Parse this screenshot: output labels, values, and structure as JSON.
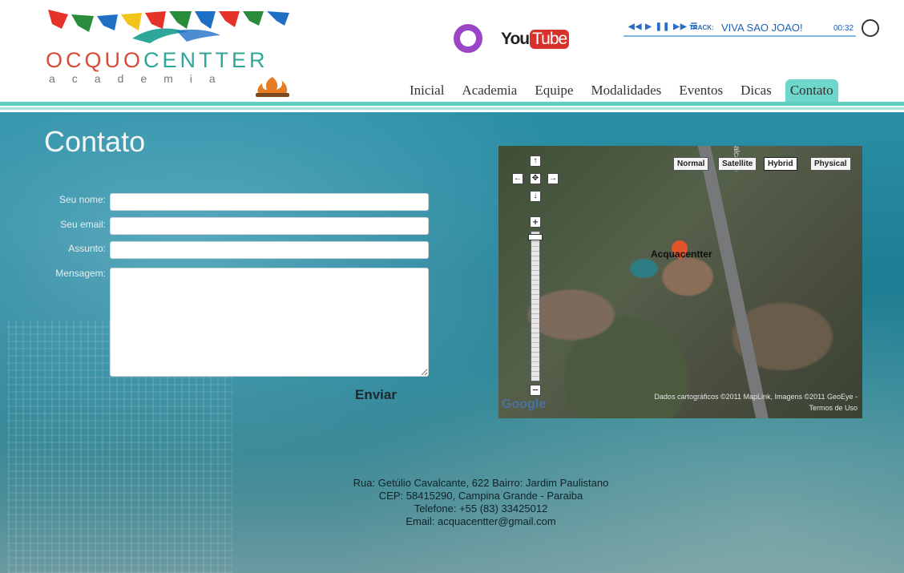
{
  "logo": {
    "name_prefix": "OCQUO",
    "name_suffix": "CENTTER",
    "subtitle": "academia"
  },
  "social": {
    "youtube_you": "You",
    "youtube_tube": "Tube"
  },
  "player": {
    "controls": "◀◀ ▶ ❚❚ ▶▶ ☰",
    "track_label": "TRACK:",
    "track_name": "VIVA SAO JOAO!",
    "time": "00:32"
  },
  "nav": {
    "items": [
      {
        "label": "Inicial"
      },
      {
        "label": "Academia"
      },
      {
        "label": "Equipe"
      },
      {
        "label": "Modalidades"
      },
      {
        "label": "Eventos"
      },
      {
        "label": "Dicas"
      },
      {
        "label": "Contato",
        "active": true
      }
    ]
  },
  "page": {
    "title": "Contato"
  },
  "form": {
    "name_label": "Seu nome:",
    "email_label": "Seu email:",
    "subject_label": "Assunto:",
    "message_label": "Mensagem:",
    "name_value": "",
    "email_value": "",
    "subject_value": "",
    "message_value": "",
    "send_label": "Enviar"
  },
  "map": {
    "types": [
      "Normal",
      "Satellite",
      "Hybrid",
      "Physical"
    ],
    "selected_type": "Hybrid",
    "street_label": "alcante",
    "marker_label": "Acquacentter",
    "google_logo": "Google",
    "attribution": "Dados cartográficos ©2011 MapLink, Imagens ©2011 GeoEye -",
    "terms": "Termos de Uso"
  },
  "address": {
    "line1": "Rua: Getúlio Cavalcante, 622 Bairro: Jardim Paulistano",
    "line2": "CEP: 58415290, Campina Grande - Paraiba",
    "line3": "Telefone: +55 (83) 33425012",
    "line4": "Email: acquacentter@gmail.com"
  },
  "colors": {
    "accent": "#63cfc3",
    "active_tab": "#6fd6cc",
    "logo_teal": "#2ca79a",
    "youtube_red": "#d8312b",
    "orkut_purple": "#9b46c6"
  }
}
